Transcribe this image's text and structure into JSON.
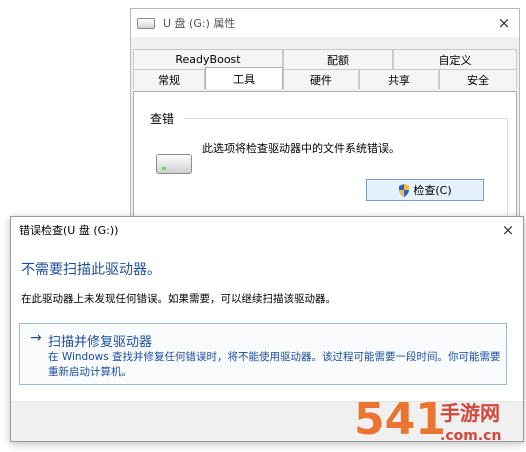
{
  "properties_window": {
    "title": "U 盘 (G:) 属性",
    "close_glyph": "×",
    "tabs_row1": [
      "ReadyBoost",
      "配额",
      "自定义"
    ],
    "tabs_row2": [
      "常规",
      "工具",
      "硬件",
      "共享",
      "安全"
    ],
    "selected_tab": "工具",
    "group_label": "查错",
    "description": "此选项将检查驱动器中的文件系统错误。",
    "check_button": "检查(C)"
  },
  "dialog": {
    "title": "错误检查(U 盘 (G:))",
    "close_glyph": "×",
    "heading": "不需要扫描此驱动器。",
    "body": "在此驱动器上未发现任何错误。如果需要，可以继续扫描该驱动器。",
    "command_link": {
      "arrow": "→",
      "title": "扫描并修复驱动器",
      "description": "在 Windows 查找并修复任何错误时，将不能使用驱动器。该过程可能需要一段时间。你可能需要重新启动计算机。"
    }
  },
  "watermark": {
    "text": "541 手游网 .com.cn"
  },
  "colors": {
    "link_blue": "#1a4ea0",
    "heading_blue": "#1e4f9c",
    "watermark_orange": "#e8600f",
    "watermark_red": "#d0281b"
  }
}
